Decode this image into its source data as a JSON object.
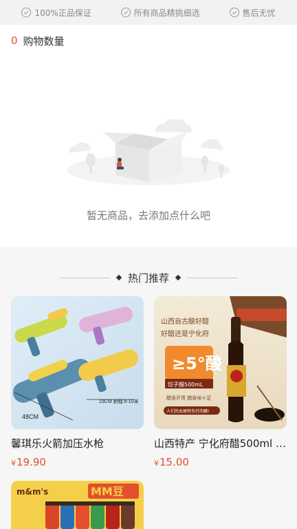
{
  "guarantees": [
    {
      "label": "100%正品保证"
    },
    {
      "label": "所有商品精挑细选"
    },
    {
      "label": "售后无忧"
    }
  ],
  "cart": {
    "count": "0",
    "label": "购物数量"
  },
  "empty": {
    "text": "暂无商品，去添加点什么吧"
  },
  "hot": {
    "title": "热门推荐"
  },
  "products": [
    {
      "name": "馨琪乐火箭加压水枪",
      "currency": "¥",
      "price": "19.90",
      "img_labels": {
        "size_a": "48CM",
        "size_b": "23CM 射程:8-10米"
      }
    },
    {
      "name": "山西特产 宁化府醋500ml …",
      "currency": "¥",
      "price": "15.00",
      "img_labels": {
        "headline1": "山西自古酿好醋",
        "headline2": "好醋还是宁化府",
        "badge_top": "≥5°酸",
        "badge_sub": "饺子醋500mL",
        "bullet": "醋香开胃 醋香味十足",
        "footer": "人们的太原特东打的醋!"
      }
    },
    {
      "name": "",
      "img_labels": {
        "brand": "m&m's",
        "title": "MM豆"
      }
    }
  ],
  "colors": {
    "accent": "#e4502d",
    "bg": "#f6f6f6"
  }
}
